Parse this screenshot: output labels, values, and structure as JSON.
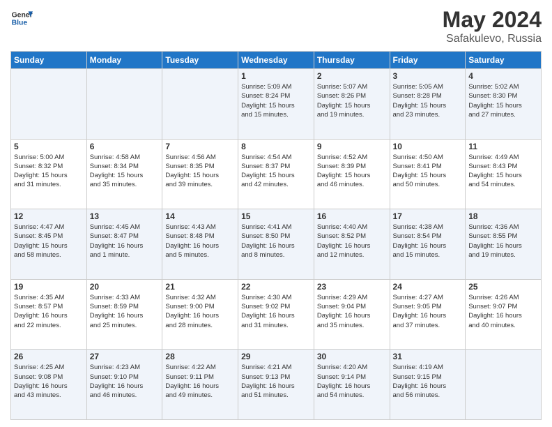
{
  "header": {
    "logo_general": "General",
    "logo_blue": "Blue",
    "month_year": "May 2024",
    "location": "Safakulevo, Russia"
  },
  "days_of_week": [
    "Sunday",
    "Monday",
    "Tuesday",
    "Wednesday",
    "Thursday",
    "Friday",
    "Saturday"
  ],
  "weeks": [
    [
      {
        "day": "",
        "info": ""
      },
      {
        "day": "",
        "info": ""
      },
      {
        "day": "",
        "info": ""
      },
      {
        "day": "1",
        "info": "Sunrise: 5:09 AM\nSunset: 8:24 PM\nDaylight: 15 hours\nand 15 minutes."
      },
      {
        "day": "2",
        "info": "Sunrise: 5:07 AM\nSunset: 8:26 PM\nDaylight: 15 hours\nand 19 minutes."
      },
      {
        "day": "3",
        "info": "Sunrise: 5:05 AM\nSunset: 8:28 PM\nDaylight: 15 hours\nand 23 minutes."
      },
      {
        "day": "4",
        "info": "Sunrise: 5:02 AM\nSunset: 8:30 PM\nDaylight: 15 hours\nand 27 minutes."
      }
    ],
    [
      {
        "day": "5",
        "info": "Sunrise: 5:00 AM\nSunset: 8:32 PM\nDaylight: 15 hours\nand 31 minutes."
      },
      {
        "day": "6",
        "info": "Sunrise: 4:58 AM\nSunset: 8:34 PM\nDaylight: 15 hours\nand 35 minutes."
      },
      {
        "day": "7",
        "info": "Sunrise: 4:56 AM\nSunset: 8:35 PM\nDaylight: 15 hours\nand 39 minutes."
      },
      {
        "day": "8",
        "info": "Sunrise: 4:54 AM\nSunset: 8:37 PM\nDaylight: 15 hours\nand 42 minutes."
      },
      {
        "day": "9",
        "info": "Sunrise: 4:52 AM\nSunset: 8:39 PM\nDaylight: 15 hours\nand 46 minutes."
      },
      {
        "day": "10",
        "info": "Sunrise: 4:50 AM\nSunset: 8:41 PM\nDaylight: 15 hours\nand 50 minutes."
      },
      {
        "day": "11",
        "info": "Sunrise: 4:49 AM\nSunset: 8:43 PM\nDaylight: 15 hours\nand 54 minutes."
      }
    ],
    [
      {
        "day": "12",
        "info": "Sunrise: 4:47 AM\nSunset: 8:45 PM\nDaylight: 15 hours\nand 58 minutes."
      },
      {
        "day": "13",
        "info": "Sunrise: 4:45 AM\nSunset: 8:47 PM\nDaylight: 16 hours\nand 1 minute."
      },
      {
        "day": "14",
        "info": "Sunrise: 4:43 AM\nSunset: 8:48 PM\nDaylight: 16 hours\nand 5 minutes."
      },
      {
        "day": "15",
        "info": "Sunrise: 4:41 AM\nSunset: 8:50 PM\nDaylight: 16 hours\nand 8 minutes."
      },
      {
        "day": "16",
        "info": "Sunrise: 4:40 AM\nSunset: 8:52 PM\nDaylight: 16 hours\nand 12 minutes."
      },
      {
        "day": "17",
        "info": "Sunrise: 4:38 AM\nSunset: 8:54 PM\nDaylight: 16 hours\nand 15 minutes."
      },
      {
        "day": "18",
        "info": "Sunrise: 4:36 AM\nSunset: 8:55 PM\nDaylight: 16 hours\nand 19 minutes."
      }
    ],
    [
      {
        "day": "19",
        "info": "Sunrise: 4:35 AM\nSunset: 8:57 PM\nDaylight: 16 hours\nand 22 minutes."
      },
      {
        "day": "20",
        "info": "Sunrise: 4:33 AM\nSunset: 8:59 PM\nDaylight: 16 hours\nand 25 minutes."
      },
      {
        "day": "21",
        "info": "Sunrise: 4:32 AM\nSunset: 9:00 PM\nDaylight: 16 hours\nand 28 minutes."
      },
      {
        "day": "22",
        "info": "Sunrise: 4:30 AM\nSunset: 9:02 PM\nDaylight: 16 hours\nand 31 minutes."
      },
      {
        "day": "23",
        "info": "Sunrise: 4:29 AM\nSunset: 9:04 PM\nDaylight: 16 hours\nand 35 minutes."
      },
      {
        "day": "24",
        "info": "Sunrise: 4:27 AM\nSunset: 9:05 PM\nDaylight: 16 hours\nand 37 minutes."
      },
      {
        "day": "25",
        "info": "Sunrise: 4:26 AM\nSunset: 9:07 PM\nDaylight: 16 hours\nand 40 minutes."
      }
    ],
    [
      {
        "day": "26",
        "info": "Sunrise: 4:25 AM\nSunset: 9:08 PM\nDaylight: 16 hours\nand 43 minutes."
      },
      {
        "day": "27",
        "info": "Sunrise: 4:23 AM\nSunset: 9:10 PM\nDaylight: 16 hours\nand 46 minutes."
      },
      {
        "day": "28",
        "info": "Sunrise: 4:22 AM\nSunset: 9:11 PM\nDaylight: 16 hours\nand 49 minutes."
      },
      {
        "day": "29",
        "info": "Sunrise: 4:21 AM\nSunset: 9:13 PM\nDaylight: 16 hours\nand 51 minutes."
      },
      {
        "day": "30",
        "info": "Sunrise: 4:20 AM\nSunset: 9:14 PM\nDaylight: 16 hours\nand 54 minutes."
      },
      {
        "day": "31",
        "info": "Sunrise: 4:19 AM\nSunset: 9:15 PM\nDaylight: 16 hours\nand 56 minutes."
      },
      {
        "day": "",
        "info": ""
      }
    ]
  ]
}
